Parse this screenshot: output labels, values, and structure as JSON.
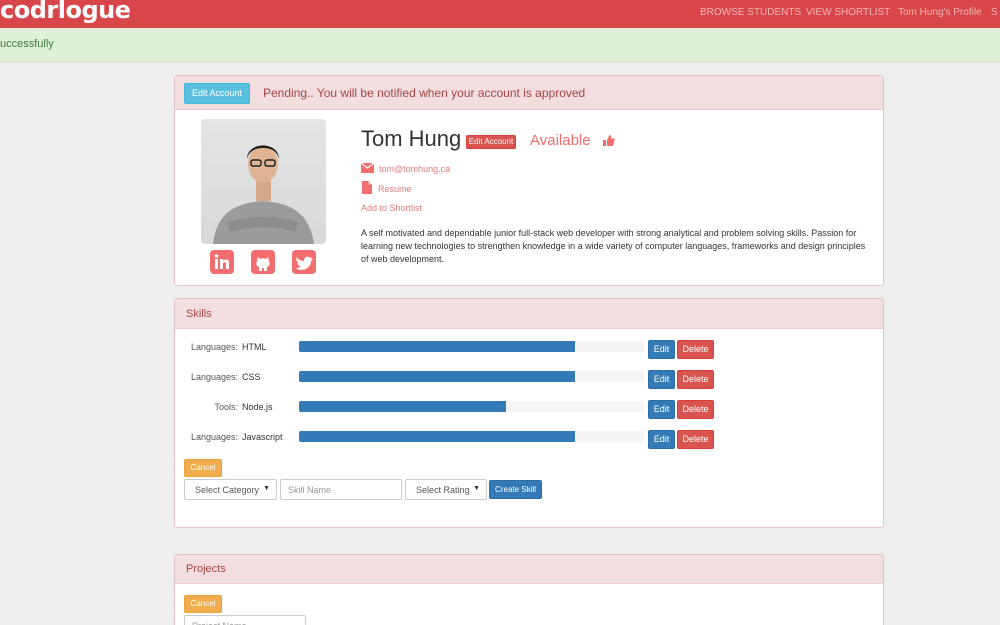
{
  "nav": {
    "brand": "codrlogue",
    "links": [
      "BROWSE STUDENTS",
      "VIEW SHORTLIST",
      "Tom Hung's Profile",
      "S"
    ]
  },
  "alert": {
    "text": "uccessfully"
  },
  "profile": {
    "edit_account_label": "Edit Account",
    "pending_text": "Pending.. You will be notified when your account is approved",
    "name": "Tom Hung",
    "name_badge": "Edit Account",
    "availability": "Available",
    "email": "tom@tomhung.ca",
    "resume_label": "Resume",
    "shortlist_label": "Add to Shortlist",
    "bio": "A self motivated and dependable junior full-stack web developer with strong analytical and problem solving skills. Passion for learning new technologies to strengthen knowledge in a wide variety of computer languages, frameworks and design principles of web development.",
    "social_icons": [
      "linkedin-icon",
      "github-icon",
      "twitter-icon"
    ]
  },
  "skills": {
    "title": "Skills",
    "items": [
      {
        "category": "Languages:",
        "name": "HTML",
        "level": 0.8
      },
      {
        "category": "Languages:",
        "name": "CSS",
        "level": 0.8
      },
      {
        "category": "Tools:",
        "name": "Node.js",
        "level": 0.6
      },
      {
        "category": "Languages:",
        "name": "Javascript",
        "level": 0.8
      }
    ],
    "edit_label": "Edit",
    "delete_label": "Delete",
    "cancel_label": "Cancel",
    "form": {
      "category_select": "Select Category",
      "skill_name_placeholder": "Skill Name",
      "rating_select": "Select Rating",
      "create_label": "Create Skill"
    }
  },
  "projects": {
    "title": "Projects",
    "cancel_label": "Cancel",
    "project_name_placeholder": "Project Name"
  },
  "colors": {
    "navbar": "#d9464a",
    "accent": "#f26d6d",
    "primary": "#337ab7",
    "danger": "#d9534f",
    "warning": "#f0ad4e",
    "info": "#5bc0de"
  }
}
